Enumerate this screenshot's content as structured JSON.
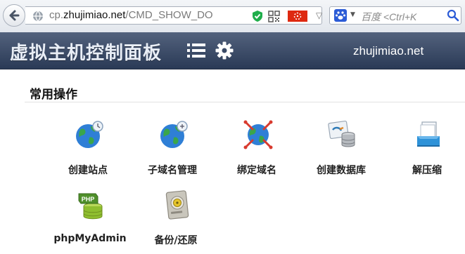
{
  "browser": {
    "url_prefix": "cp.",
    "url_domain": "zhujimiao.net",
    "url_path": "/CMD_SHOW_DO",
    "search_placeholder": "百度 <Ctrl+K",
    "icons": [
      "back-arrow-icon",
      "globe-icon",
      "shield-icon",
      "qr-code-icon",
      "hk-flag-icon",
      "dropdown-arrow-icon",
      "reload-icon",
      "baidu-paw-icon",
      "magnifier-icon"
    ]
  },
  "header": {
    "title": "虚拟主机控制面板",
    "site_name": "zhujimiao.net",
    "icons": [
      "menu-icon",
      "gear-icon"
    ]
  },
  "section": {
    "title": "常用操作"
  },
  "actions": [
    {
      "label": "创建站点",
      "icon": "globe-site-icon"
    },
    {
      "label": "子域名管理",
      "icon": "globe-subdomain-icon"
    },
    {
      "label": "绑定域名",
      "icon": "globe-bind-icon"
    },
    {
      "label": "创建数据库",
      "icon": "mysql-database-icon"
    },
    {
      "label": "解压缩",
      "icon": "archive-box-icon"
    },
    {
      "label": "phpMyAdmin",
      "icon": "php-database-icon"
    },
    {
      "label": "备份/还原",
      "icon": "backup-disk-icon"
    }
  ],
  "colors": {
    "header_top": "#53627d",
    "header_bottom": "#2a3a56",
    "flag_red": "#de2910",
    "baidu_blue": "#2b5bd6"
  }
}
